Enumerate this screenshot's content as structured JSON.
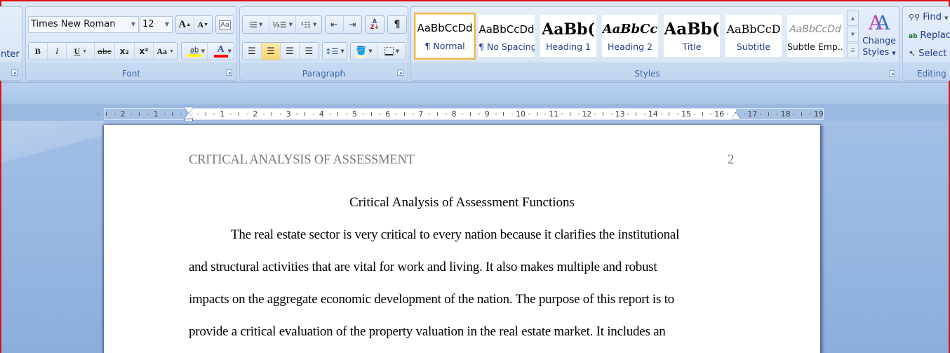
{
  "ribbon": {
    "clipboard": {
      "partial_label": "nter"
    },
    "font": {
      "label": "Font",
      "font_name": "Times New Roman",
      "font_size": "12",
      "grow_font": "A",
      "shrink_font": "A",
      "bold": "B",
      "italic": "I",
      "underline": "U",
      "strikethrough": "abc",
      "subscript": "x₂",
      "superscript": "x²",
      "change_case": "Aa",
      "highlight": "ab",
      "font_color": "A",
      "highlight_color": "#ffff00",
      "font_color_value": "#ff0000"
    },
    "paragraph": {
      "label": "Paragraph",
      "sort": "A Z",
      "show_marks": "¶",
      "active_alignment": "center"
    },
    "styles": {
      "label": "Styles",
      "items": [
        {
          "preview": "AaBbCcDd",
          "name": "¶ Normal",
          "selected": true
        },
        {
          "preview": "AaBbCcDd",
          "name": "¶ No Spacing"
        },
        {
          "preview": "AaBb(",
          "name": "Heading 1"
        },
        {
          "preview": "AaBbCc",
          "name": "Heading 2"
        },
        {
          "preview": "AaBb(",
          "name": "Title"
        },
        {
          "preview": "AaBbCcD",
          "name": "Subtitle"
        },
        {
          "preview": "AaBbCcDd",
          "name": "Subtle Emp..."
        }
      ],
      "change_styles_line1": "Change",
      "change_styles_line2": "Styles"
    },
    "editing": {
      "label": "Editing",
      "find": "Find",
      "replace": "Replac",
      "select": "Select"
    }
  },
  "ruler": {
    "left_numbers": [
      "2",
      "1"
    ],
    "right_numbers": [
      "1",
      "2",
      "3",
      "4",
      "5",
      "6",
      "7",
      "8",
      "9",
      "10",
      "11",
      "12",
      "13",
      "14",
      "15",
      "16",
      "17",
      "18",
      "19"
    ]
  },
  "document": {
    "header_text": "CRITICAL ANALYSIS OF ASSESSMENT",
    "page_number": "2",
    "title": "Critical Analysis of Assessment Functions",
    "lines": [
      "The real estate sector is very critical to every nation because it clarifies the institutional",
      "and structural activities that are vital for work and living. It also makes multiple and robust",
      "impacts on the aggregate economic development of the nation. The purpose of this report is to",
      "provide a critical evaluation of the property valuation in the real estate market. It includes an"
    ]
  }
}
